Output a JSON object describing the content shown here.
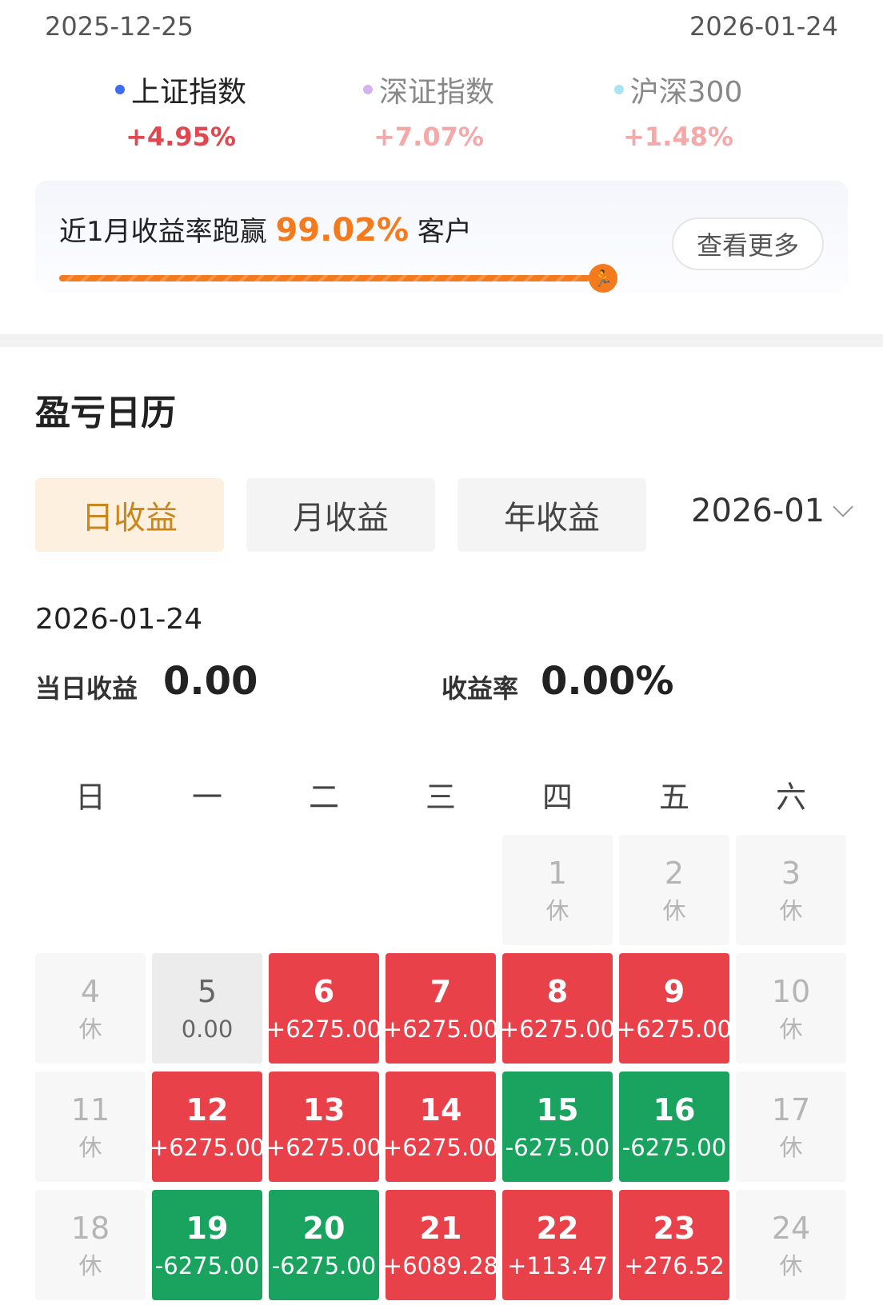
{
  "range": {
    "start": "2025-12-25",
    "end": "2026-01-24"
  },
  "indices": [
    {
      "name": "上证指数",
      "change": "+4.95%",
      "dot_color": "#3d6df2",
      "text_color": "#e0474f"
    },
    {
      "name": "深证指数",
      "change": "+7.07%",
      "dot_color": "#d3b2f0",
      "text_color": "#f4a9a8"
    },
    {
      "name": "沪深300",
      "change": "+1.48%",
      "dot_color": "#a9e4f5",
      "text_color": "#f4a9a8"
    }
  ],
  "beat_card": {
    "prefix": "近1月收益率跑赢",
    "percent": "99.02%",
    "suffix": "客户",
    "more_label": "查看更多",
    "progress": 0.9902
  },
  "calendar": {
    "title": "盈亏日历",
    "tabs": [
      "日收益",
      "月收益",
      "年收益"
    ],
    "active_tab": 0,
    "month": "2026-01",
    "selected_date": "2026-01-24",
    "daily_profit_label": "当日收益",
    "daily_profit_value": "0.00",
    "rate_label": "收益率",
    "rate_value": "0.00%",
    "weekdays": [
      "日",
      "一",
      "二",
      "三",
      "四",
      "五",
      "六"
    ],
    "first_weekday": 4,
    "rest_label": "休",
    "days": [
      {
        "day": "1",
        "value": "休",
        "type": "rest"
      },
      {
        "day": "2",
        "value": "休",
        "type": "rest"
      },
      {
        "day": "3",
        "value": "休",
        "type": "rest"
      },
      {
        "day": "4",
        "value": "休",
        "type": "rest"
      },
      {
        "day": "5",
        "value": "0.00",
        "type": "zero"
      },
      {
        "day": "6",
        "value": "+6275.00",
        "type": "up"
      },
      {
        "day": "7",
        "value": "+6275.00",
        "type": "up"
      },
      {
        "day": "8",
        "value": "+6275.00",
        "type": "up"
      },
      {
        "day": "9",
        "value": "+6275.00",
        "type": "up"
      },
      {
        "day": "10",
        "value": "休",
        "type": "rest"
      },
      {
        "day": "11",
        "value": "休",
        "type": "rest"
      },
      {
        "day": "12",
        "value": "+6275.00",
        "type": "up"
      },
      {
        "day": "13",
        "value": "+6275.00",
        "type": "up"
      },
      {
        "day": "14",
        "value": "+6275.00",
        "type": "up"
      },
      {
        "day": "15",
        "value": "-6275.00",
        "type": "down"
      },
      {
        "day": "16",
        "value": "-6275.00",
        "type": "down"
      },
      {
        "day": "17",
        "value": "休",
        "type": "rest"
      },
      {
        "day": "18",
        "value": "休",
        "type": "rest"
      },
      {
        "day": "19",
        "value": "-6275.00",
        "type": "down"
      },
      {
        "day": "20",
        "value": "-6275.00",
        "type": "down"
      },
      {
        "day": "21",
        "value": "+6089.28",
        "type": "up"
      },
      {
        "day": "22",
        "value": "+113.47",
        "type": "up"
      },
      {
        "day": "23",
        "value": "+276.52",
        "type": "up"
      },
      {
        "day": "24",
        "value": "休",
        "type": "rest"
      }
    ]
  }
}
